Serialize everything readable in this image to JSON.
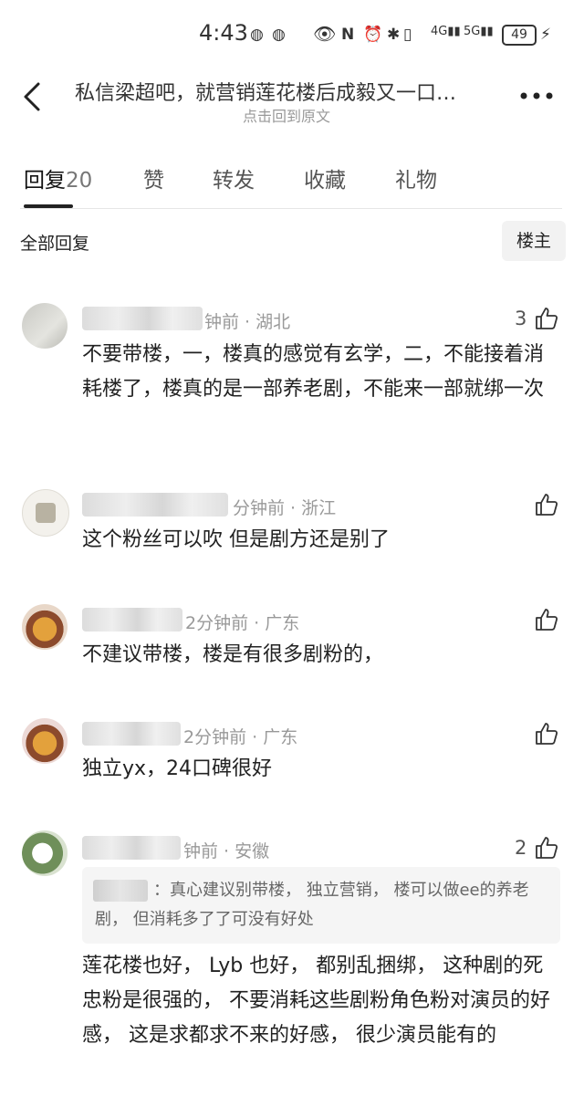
{
  "status_bar": {
    "time": "4:43",
    "battery": "49"
  },
  "header": {
    "title": "私信梁超吧，就营销莲花楼后成毅又一口…",
    "subtitle": "点击回到原文"
  },
  "tabs": [
    {
      "label": "回复",
      "count": "20"
    },
    {
      "label": "赞"
    },
    {
      "label": "转发"
    },
    {
      "label": "收藏"
    },
    {
      "label": "礼物"
    }
  ],
  "filter": {
    "all_replies_label": "全部回复",
    "op_only_label": "楼主"
  },
  "comments": [
    {
      "meta": "钟前 · 湖北",
      "likes": "3",
      "text": "不要带楼，一，楼真的感觉有玄学，二，不能接着消耗楼了，楼真的是一部养老剧，不能来一部就绑一次"
    },
    {
      "meta": "分钟前 · 浙江",
      "likes": "",
      "text": "这个粉丝可以吹 但是剧方还是别了"
    },
    {
      "meta": "2分钟前 · 广东",
      "likes": "",
      "text": "不建议带楼，楼是有很多剧粉的，"
    },
    {
      "meta": "2分钟前 · 广东",
      "likes": "",
      "text": "独立yx，24口碑很好"
    },
    {
      "meta": "钟前 · 安徽",
      "likes": "2",
      "text": "莲花楼也好， Lyb 也好， 都别乱捆绑， 这种剧的死忠粉是很强的， 不要消耗这些剧粉角色粉对演员的好感， 这是求都求不来的好感， 很少演员能有的",
      "quote": "：真心建议别带楼， 独立营销， 楼可以做ee的养老剧， 但消耗多了了可没有好处"
    }
  ],
  "colors": {
    "text": "#222222",
    "meta": "#999999",
    "quote_bg": "#f5f5f5",
    "tab_active": "#111111"
  }
}
